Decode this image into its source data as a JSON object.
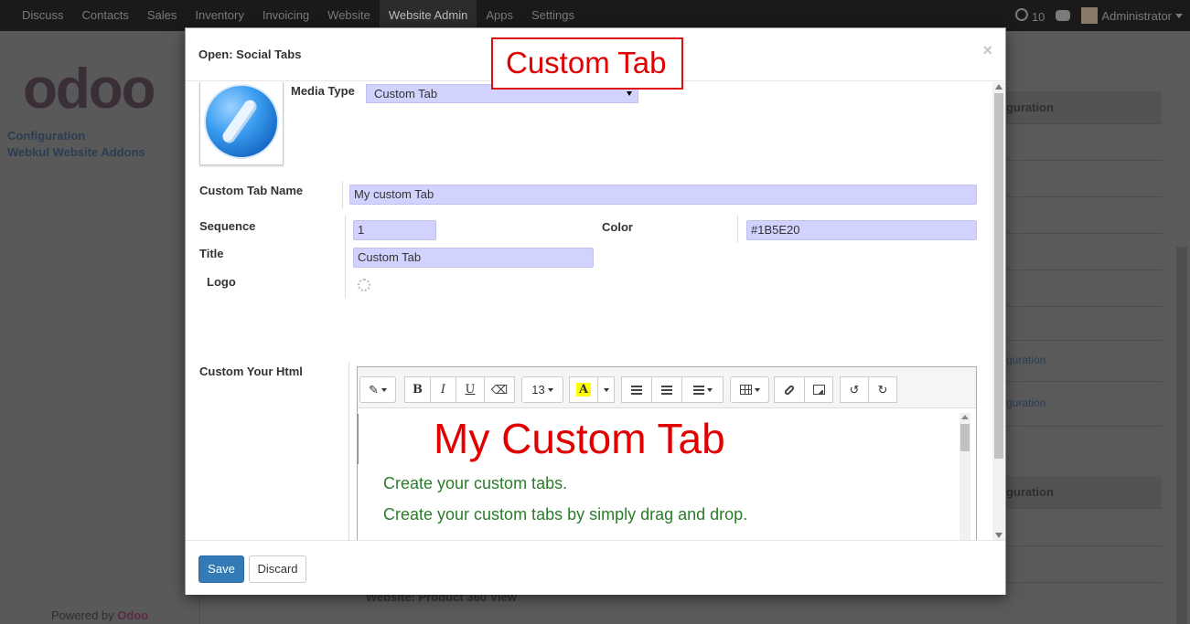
{
  "navbar": {
    "menu": [
      "Discuss",
      "Contacts",
      "Sales",
      "Inventory",
      "Invoicing",
      "Website",
      "Website Admin",
      "Apps",
      "Settings"
    ],
    "active_index": 6,
    "notifications": "10",
    "user": "Administrator"
  },
  "sidebar": {
    "logo_text": "odoo",
    "links": [
      "Configuration",
      "Webkul Website Addons"
    ],
    "powered_by": "Powered by",
    "powered_brand": "Odoo"
  },
  "background": {
    "cfg_header_1": "figuration",
    "cfg_header_2": "figuration",
    "cfg_link_1": "figuration",
    "cfg_link_2": "figuration",
    "bottom_row_text": "Website: Product 360 View"
  },
  "annotation": {
    "text": "Custom Tab",
    "color": "#e00000"
  },
  "modal": {
    "title": "Open: Social Tabs",
    "close_symbol": "×",
    "form": {
      "media_type_label": "Media Type",
      "media_type_value": "Custom Tab",
      "custom_tab_name_label": "Custom Tab Name",
      "custom_tab_name_value": "My custom Tab",
      "sequence_label": "Sequence",
      "sequence_value": "1",
      "color_label": "Color",
      "color_value": "#1B5E20",
      "title_label": "Title",
      "title_value": "Custom Tab",
      "logo_label": "Logo",
      "custom_html_label": "Custom Your Html"
    },
    "editor": {
      "toolbar": {
        "style": "magic-wand-icon",
        "bold": "B",
        "italic": "I",
        "underline": "U",
        "eraser": "eraser-icon",
        "font_size": "13",
        "color_letter": "A"
      },
      "heading": "My Custom Tab",
      "heading_color": "#e00000",
      "paragraphs": [
        "Create your custom tabs.",
        "Create your custom tabs by simply drag and drop."
      ],
      "paragraph_color": "#2a7c2a"
    },
    "footer": {
      "save_label": "Save",
      "discard_label": "Discard"
    }
  }
}
